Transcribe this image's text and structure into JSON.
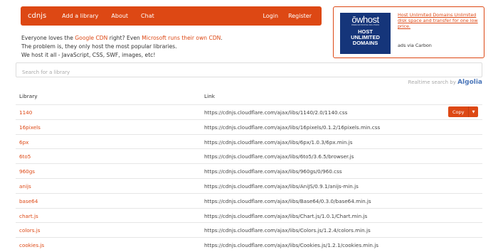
{
  "nav": {
    "brand": "cdnjs",
    "items": [
      "Add a library",
      "About",
      "Chat"
    ],
    "right": [
      "Login",
      "Register"
    ]
  },
  "intro": {
    "line1_a": "Everyone loves the ",
    "line1_link1": "Google CDN",
    "line1_b": " right? Even ",
    "line1_link2": "Microsoft runs their own CDN",
    "line1_c": ".",
    "line2": "The problem is, they only host the most popular libraries.",
    "line3": "We host it all - JavaScript, CSS, SWF, images, etc!"
  },
  "ad": {
    "logo": "ōwhost",
    "tagline": "PREMIUM HOSTING SOLUTIONS",
    "big_line1": "HOST",
    "big_line2": "UNLIMITED",
    "big_line3": "DOMAINS",
    "text": "Host Unlimited Domains Unlimited disk space and transfer for one low price.",
    "via": "ads via Carbon"
  },
  "search": {
    "placeholder": "Search for a library",
    "powered_prefix": "Realtime search by",
    "powered_brand": "Algolia"
  },
  "table": {
    "headers": [
      "Library",
      "Link"
    ],
    "copy_label": "Copy",
    "rows": [
      {
        "name": "1140",
        "url": "https://cdnjs.cloudflare.com/ajax/libs/1140/2.0/1140.css"
      },
      {
        "name": "16pixels",
        "url": "https://cdnjs.cloudflare.com/ajax/libs/16pixels/0.1.2/16pixels.min.css"
      },
      {
        "name": "6px",
        "url": "https://cdnjs.cloudflare.com/ajax/libs/6px/1.0.3/6px.min.js"
      },
      {
        "name": "6to5",
        "url": "https://cdnjs.cloudflare.com/ajax/libs/6to5/3.6.5/browser.js"
      },
      {
        "name": "960gs",
        "url": "https://cdnjs.cloudflare.com/ajax/libs/960gs/0/960.css"
      },
      {
        "name": "anijs",
        "url": "https://cdnjs.cloudflare.com/ajax/libs/AniJS/0.9.1/anijs-min.js"
      },
      {
        "name": "base64",
        "url": "https://cdnjs.cloudflare.com/ajax/libs/Base64/0.3.0/base64.min.js"
      },
      {
        "name": "chart.js",
        "url": "https://cdnjs.cloudflare.com/ajax/libs/Chart.js/1.0.1/Chart.min.js"
      },
      {
        "name": "colors.js",
        "url": "https://cdnjs.cloudflare.com/ajax/libs/Colors.js/1.2.4/colors.min.js"
      },
      {
        "name": "cookies.js",
        "url": "https://cdnjs.cloudflare.com/ajax/libs/Cookies.js/1.2.1/cookies.min.js"
      }
    ]
  },
  "colors": {
    "accent": "#dd4814",
    "ad_bg": "#15357a",
    "algolia": "#4b76b9"
  }
}
